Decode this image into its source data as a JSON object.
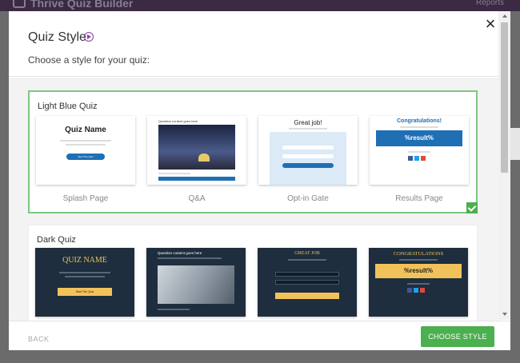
{
  "app": {
    "title": "Thrive Quiz Builder",
    "reports_label": "Reports"
  },
  "modal": {
    "title": "Quiz Style",
    "subtitle": "Choose a style for your quiz:",
    "close_symbol": "×",
    "back_label": "BACK",
    "choose_label": "CHOOSE STYLE"
  },
  "styles": [
    {
      "name": "Light Blue Quiz",
      "selected": true,
      "thumbs": [
        {
          "label": "Splash Page",
          "preview_title": "Quiz Name",
          "preview_button": "Start The Quiz"
        },
        {
          "label": "Q&A",
          "preview_title": "Question content goes here"
        },
        {
          "label": "Opt-in Gate",
          "preview_title": "Great job!"
        },
        {
          "label": "Results Page",
          "preview_title": "Congratulations!",
          "preview_result": "%result%"
        }
      ]
    },
    {
      "name": "Dark Quiz",
      "selected": false,
      "thumbs": [
        {
          "preview_title": "QUIZ NAME",
          "preview_button": "Start The Quiz"
        },
        {
          "preview_title": "Question content goes here"
        },
        {
          "preview_title": "GREAT JOB"
        },
        {
          "preview_title": "CONGRATULATIONS",
          "preview_result": "%result%"
        }
      ]
    }
  ],
  "colors": {
    "accent_green": "#4caf50",
    "brand_blue": "#1f6fb5",
    "dark_bg": "#1f2e3e",
    "gold": "#f2c25a"
  }
}
